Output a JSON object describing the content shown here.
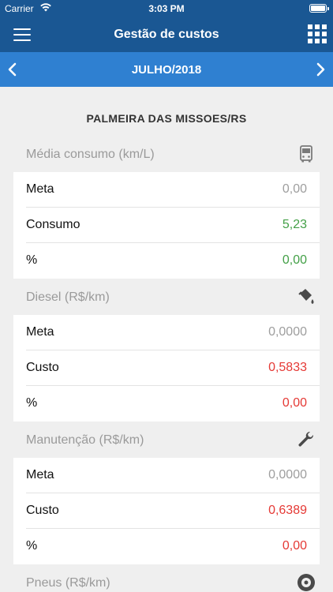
{
  "status_bar": {
    "carrier": "Carrier",
    "time": "3:03 PM"
  },
  "header": {
    "title": "Gestão de custos"
  },
  "month_selector": {
    "label": "JULHO/2018"
  },
  "location": "PALMEIRA DAS MISSOES/RS",
  "sections": [
    {
      "title": "Média consumo (km/L)",
      "icon": "bus-icon",
      "rows": [
        {
          "label": "Meta",
          "value": "0,00"
        },
        {
          "label": "Consumo",
          "value": "5,23"
        },
        {
          "label": "%",
          "value": "0,00"
        }
      ]
    },
    {
      "title": "Diesel (R$/km)",
      "icon": "fuel-can-icon",
      "rows": [
        {
          "label": "Meta",
          "value": "0,0000"
        },
        {
          "label": "Custo",
          "value": "0,5833"
        },
        {
          "label": "%",
          "value": "0,00"
        }
      ]
    },
    {
      "title": "Manutenção (R$/km)",
      "icon": "wrench-icon",
      "rows": [
        {
          "label": "Meta",
          "value": "0,0000"
        },
        {
          "label": "Custo",
          "value": "0,6389"
        },
        {
          "label": "%",
          "value": "0,00"
        }
      ]
    },
    {
      "title": "Pneus (R$/km)",
      "icon": "tire-icon",
      "rows": []
    }
  ],
  "colors": {
    "header_bg": "#1a5793",
    "month_bar_bg": "#2f80d1",
    "neutral_value": "#9e9e9e",
    "positive_value": "#43a047",
    "negative_value": "#e53935"
  }
}
